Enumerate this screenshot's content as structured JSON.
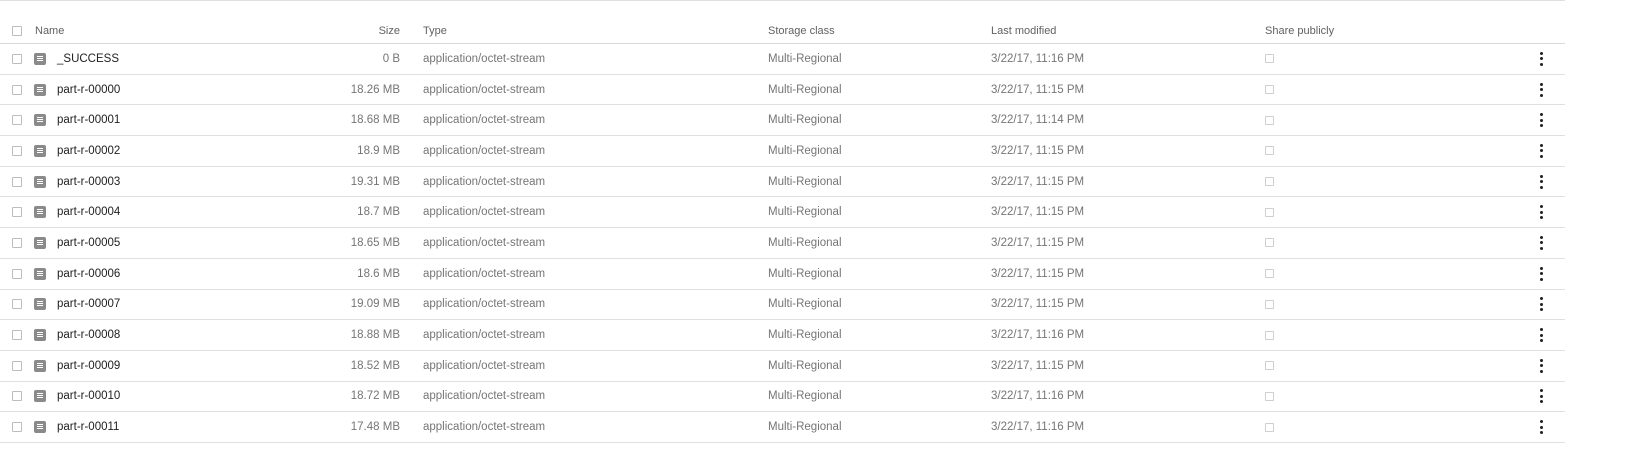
{
  "columns": {
    "name": "Name",
    "size": "Size",
    "type": "Type",
    "storage": "Storage class",
    "modified": "Last modified",
    "share": "Share publicly"
  },
  "rows": [
    {
      "name": "_SUCCESS",
      "size": "0 B",
      "type": "application/octet-stream",
      "storage": "Multi-Regional",
      "modified": "3/22/17, 11:16 PM"
    },
    {
      "name": "part-r-00000",
      "size": "18.26 MB",
      "type": "application/octet-stream",
      "storage": "Multi-Regional",
      "modified": "3/22/17, 11:15 PM"
    },
    {
      "name": "part-r-00001",
      "size": "18.68 MB",
      "type": "application/octet-stream",
      "storage": "Multi-Regional",
      "modified": "3/22/17, 11:14 PM"
    },
    {
      "name": "part-r-00002",
      "size": "18.9 MB",
      "type": "application/octet-stream",
      "storage": "Multi-Regional",
      "modified": "3/22/17, 11:15 PM"
    },
    {
      "name": "part-r-00003",
      "size": "19.31 MB",
      "type": "application/octet-stream",
      "storage": "Multi-Regional",
      "modified": "3/22/17, 11:15 PM"
    },
    {
      "name": "part-r-00004",
      "size": "18.7 MB",
      "type": "application/octet-stream",
      "storage": "Multi-Regional",
      "modified": "3/22/17, 11:15 PM"
    },
    {
      "name": "part-r-00005",
      "size": "18.65 MB",
      "type": "application/octet-stream",
      "storage": "Multi-Regional",
      "modified": "3/22/17, 11:15 PM"
    },
    {
      "name": "part-r-00006",
      "size": "18.6 MB",
      "type": "application/octet-stream",
      "storage": "Multi-Regional",
      "modified": "3/22/17, 11:15 PM"
    },
    {
      "name": "part-r-00007",
      "size": "19.09 MB",
      "type": "application/octet-stream",
      "storage": "Multi-Regional",
      "modified": "3/22/17, 11:15 PM"
    },
    {
      "name": "part-r-00008",
      "size": "18.88 MB",
      "type": "application/octet-stream",
      "storage": "Multi-Regional",
      "modified": "3/22/17, 11:16 PM"
    },
    {
      "name": "part-r-00009",
      "size": "18.52 MB",
      "type": "application/octet-stream",
      "storage": "Multi-Regional",
      "modified": "3/22/17, 11:15 PM"
    },
    {
      "name": "part-r-00010",
      "size": "18.72 MB",
      "type": "application/octet-stream",
      "storage": "Multi-Regional",
      "modified": "3/22/17, 11:16 PM"
    },
    {
      "name": "part-r-00011",
      "size": "17.48 MB",
      "type": "application/octet-stream",
      "storage": "Multi-Regional",
      "modified": "3/22/17, 11:16 PM"
    }
  ],
  "icons": {
    "file": "file-icon",
    "menu": "more-vert-icon"
  },
  "colors": {
    "divider": "#e0e0e0",
    "text": "#212121",
    "muted": "#757575"
  }
}
